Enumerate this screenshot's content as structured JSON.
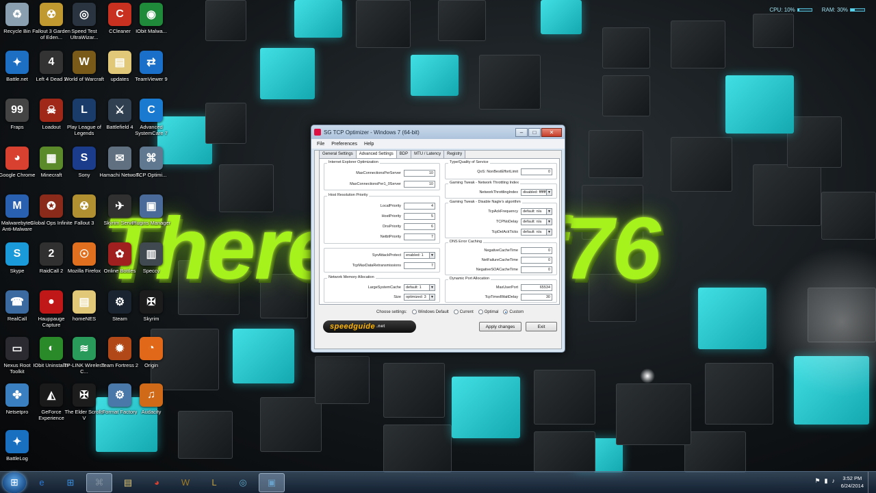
{
  "system_stats": {
    "cpu_label": "CPU: 10%",
    "cpu_fraction": 0.1,
    "ram_label": "RAM: 30%",
    "ram_fraction": 0.3
  },
  "wallpaper_text": "Therealsurf76",
  "desktop_icons": [
    {
      "label": "Recycle Bin",
      "icon": "recycle-bin-icon",
      "color": "#8aa0b0",
      "glyph": "♻"
    },
    {
      "label": "Fallout 3 Garden of Eden...",
      "icon": "fallout-icon",
      "color": "#c09a30",
      "glyph": "☢"
    },
    {
      "label": "Speed Test UltraWizar...",
      "icon": "speedometer-icon",
      "color": "#2a3440",
      "glyph": "◎"
    },
    {
      "label": "CCleaner",
      "icon": "ccleaner-icon",
      "color": "#c83020",
      "glyph": "C"
    },
    {
      "label": "IObit Malwa...",
      "icon": "iobit-icon",
      "color": "#1f8a3a",
      "glyph": "◉"
    },
    {
      "label": "Battle.net",
      "icon": "battlenet-icon",
      "color": "#1d6fc4",
      "glyph": "✦"
    },
    {
      "label": "Left 4 Dead 2",
      "icon": "l4d2-icon",
      "color": "#333",
      "glyph": "4"
    },
    {
      "label": "World of Warcraft",
      "icon": "wow-icon",
      "color": "#7a5a18",
      "glyph": "W"
    },
    {
      "label": "updates",
      "icon": "folder-icon",
      "color": "#e0c878",
      "glyph": "▤"
    },
    {
      "label": "TeamViewer 9",
      "icon": "teamviewer-icon",
      "color": "#1a70c8",
      "glyph": "⇄"
    },
    {
      "label": "Fraps",
      "icon": "fraps-icon",
      "color": "#444",
      "glyph": "99"
    },
    {
      "label": "Loadout",
      "icon": "loadout-icon",
      "color": "#a02818",
      "glyph": "☠"
    },
    {
      "label": "Play League of Legends",
      "icon": "league-icon",
      "color": "#1a3c6a",
      "glyph": "L"
    },
    {
      "label": "Battlefield 4",
      "icon": "battlefield-icon",
      "color": "#304050",
      "glyph": "⚔"
    },
    {
      "label": "Advanced SystemCare 7",
      "icon": "systemcare-icon",
      "color": "#1a7ad0",
      "glyph": "C"
    },
    {
      "label": "Google Chrome",
      "icon": "chrome-icon",
      "color": "#d84030",
      "glyph": "◕"
    },
    {
      "label": "Minecraft",
      "icon": "minecraft-icon",
      "color": "#5a8a2a",
      "glyph": "▦"
    },
    {
      "label": "Sony",
      "icon": "sony-icon",
      "color": "#1a3c8a",
      "glyph": "S"
    },
    {
      "label": "Hamachi Network",
      "icon": "hamachi-icon",
      "color": "#607080",
      "glyph": "✉"
    },
    {
      "label": "TCP Optimi...",
      "icon": "tcp-optimizer-icon",
      "color": "#607890",
      "glyph": "⌘"
    },
    {
      "label": "Malwarebytes Anti-Malware",
      "icon": "malwarebytes-icon",
      "color": "#2a60b0",
      "glyph": "M"
    },
    {
      "label": "Global Ops Infinite",
      "icon": "globalops-icon",
      "color": "#8a2a1a",
      "glyph": "✪"
    },
    {
      "label": "Fallout 3",
      "icon": "fallout3-icon",
      "color": "#b09030",
      "glyph": "☢"
    },
    {
      "label": "Skyrim Server",
      "icon": "skyrim-server-icon",
      "color": "#303030",
      "glyph": "✈"
    },
    {
      "label": "Plugins Manager",
      "icon": "plugins-manager-icon",
      "color": "#4a6a9a",
      "glyph": "▣"
    },
    {
      "label": "Skype",
      "icon": "skype-icon",
      "color": "#1a9ad8",
      "glyph": "S"
    },
    {
      "label": "RaidCall 2",
      "icon": "raidcall-icon",
      "color": "#303030",
      "glyph": "2"
    },
    {
      "label": "Mozilla Firefox",
      "icon": "firefox-icon",
      "color": "#e07020",
      "glyph": "☉"
    },
    {
      "label": "Online Bottles",
      "icon": "bottles-icon",
      "color": "#a02020",
      "glyph": "✿"
    },
    {
      "label": "Speccy",
      "icon": "speccy-icon",
      "color": "#404850",
      "glyph": "▥"
    },
    {
      "label": "RealCall",
      "icon": "realcall-icon",
      "color": "#3a6aa0",
      "glyph": "☎"
    },
    {
      "label": "Hauppauge Capture",
      "icon": "hauppauge-icon",
      "color": "#c01818",
      "glyph": "●"
    },
    {
      "label": "homeNES",
      "icon": "homenes-folder-icon",
      "color": "#e0c878",
      "glyph": "▤"
    },
    {
      "label": "Steam",
      "icon": "steam-icon",
      "color": "#1a2430",
      "glyph": "⚙"
    },
    {
      "label": "Skyrim",
      "icon": "skyrim-icon",
      "color": "#1c1c1c",
      "glyph": "✠"
    },
    {
      "label": "Nexus Root Toolkit",
      "icon": "nexus-root-icon",
      "color": "#2a2a30",
      "glyph": "▭"
    },
    {
      "label": "IObit Uninstaller",
      "icon": "iobit-uninstaller-icon",
      "color": "#2a8a2a",
      "glyph": "◐"
    },
    {
      "label": "TP-LINK Wireless C...",
      "icon": "tplink-icon",
      "color": "#2a9a5a",
      "glyph": "≋"
    },
    {
      "label": "Team Fortress 2",
      "icon": "tf2-icon",
      "color": "#b04818",
      "glyph": "✹"
    },
    {
      "label": "Origin",
      "icon": "origin-icon",
      "color": "#e06818",
      "glyph": "◔"
    },
    {
      "label": "Netsetpro",
      "icon": "netsetpro-icon",
      "color": "#3a80c0",
      "glyph": "✤"
    },
    {
      "label": "GeForce Experience",
      "icon": "geforce-icon",
      "color": "#1a1a1a",
      "glyph": "◭"
    },
    {
      "label": "The Elder Scrolls V",
      "icon": "tes-icon",
      "color": "#1c1c1c",
      "glyph": "✠"
    },
    {
      "label": "Format Factory",
      "icon": "format-factory-icon",
      "color": "#4a78a8",
      "glyph": "⚙"
    },
    {
      "label": "Audacity",
      "icon": "audacity-icon",
      "color": "#d06a18",
      "glyph": "♫"
    },
    {
      "label": "BattleLog",
      "icon": "battlelog-icon",
      "color": "#1a70c0",
      "glyph": "✦"
    }
  ],
  "app_window": {
    "title": "SG TCP Optimizer - Windows 7 (64-bit)",
    "menu": [
      "File",
      "Preferences",
      "Help"
    ],
    "tabs": [
      "General Settings",
      "Advanced Settings",
      "BDP",
      "MTU / Latency",
      "Registry"
    ],
    "active_tab": "Advanced Settings",
    "groups": {
      "ie": {
        "title": "Internet Explorer Optimization",
        "rows": [
          {
            "label": "MaxConnectionsPerServer",
            "value": "10"
          },
          {
            "label": "MaxConnectionsPer1_0Server",
            "value": "10"
          }
        ]
      },
      "host": {
        "title": "Host Resolution Priority",
        "rows": [
          {
            "label": "LocalPriority",
            "value": "4"
          },
          {
            "label": "HostPriority",
            "value": "5"
          },
          {
            "label": "DnsPriority",
            "value": "6"
          },
          {
            "label": "NetbtPriority",
            "value": "7"
          }
        ]
      },
      "syn": {
        "rows": [
          {
            "label": "SynAttackProtect",
            "value": "enabled: 1"
          },
          {
            "label": "TcpMaxDataRetransmissions",
            "value": "7"
          }
        ]
      },
      "memory": {
        "title": "Network Memory Allocation",
        "rows": [
          {
            "label": "LargeSystemCache",
            "value": "default: 1"
          },
          {
            "label": "Size",
            "value": "optimized: 3"
          }
        ]
      },
      "qos": {
        "title": "Type/Quality of Service",
        "rows": [
          {
            "label": "QoS: NonBestEffortLimit",
            "value": "0"
          }
        ]
      },
      "throttle": {
        "title": "Gaming Tweak - Network Throttling Index",
        "rows": [
          {
            "label": "NetworkThrottlingIndex",
            "value": "disabled: ffffffff"
          }
        ]
      },
      "nagle": {
        "title": "Gaming Tweak - Disable Nagle's algorithm",
        "rows": [
          {
            "label": "TcpAckFrequency",
            "value": "default: n/a"
          },
          {
            "label": "TCPNoDelay",
            "value": "default: n/a"
          },
          {
            "label": "TcpDelAckTicks",
            "value": "default: n/a"
          }
        ]
      },
      "dns": {
        "title": "DNS Error Caching",
        "rows": [
          {
            "label": "NegativeCacheTime",
            "value": "0"
          },
          {
            "label": "NetFailureCacheTime",
            "value": "0"
          },
          {
            "label": "NegativeSOACacheTime",
            "value": "0"
          }
        ]
      },
      "ports": {
        "title": "Dynamic Port Allocation",
        "rows": [
          {
            "label": "MaxUserPort",
            "value": "65534"
          },
          {
            "label": "TcpTimedWaitDelay",
            "value": "30"
          }
        ]
      }
    },
    "choose_label": "Choose settings:",
    "settings_options": [
      "Windows Default",
      "Current",
      "Optimal",
      "Custom"
    ],
    "selected_option": "Custom",
    "logo_text": "speedguide",
    "logo_suffix": ".net",
    "apply_label": "Apply changes",
    "exit_label": "Exit"
  },
  "taskbar": {
    "apps": [
      {
        "icon": "ie-icon",
        "glyph": "e",
        "color": "#2a7ad8"
      },
      {
        "icon": "windows-explorer-icon",
        "glyph": "⊞",
        "color": "#3a90e0"
      },
      {
        "icon": "tcp-optimizer-icon",
        "glyph": "⌘",
        "color": "#8090a0",
        "active": true
      },
      {
        "icon": "folder-icon",
        "glyph": "▤",
        "color": "#e0c878"
      },
      {
        "icon": "chrome-icon",
        "glyph": "◕",
        "color": "#d84030"
      },
      {
        "icon": "wow-icon",
        "glyph": "W",
        "color": "#a07a20"
      },
      {
        "icon": "league-icon",
        "glyph": "L",
        "color": "#c0a040"
      },
      {
        "icon": "speedtest-icon",
        "glyph": "◎",
        "color": "#60a8c8"
      },
      {
        "icon": "remote-desktop-icon",
        "glyph": "▣",
        "color": "#6aa0c8",
        "active": true
      }
    ],
    "tray_icons": [
      "flag-icon",
      "network-icon",
      "volume-icon"
    ],
    "time": "3:52 PM",
    "date": "6/24/2014"
  }
}
